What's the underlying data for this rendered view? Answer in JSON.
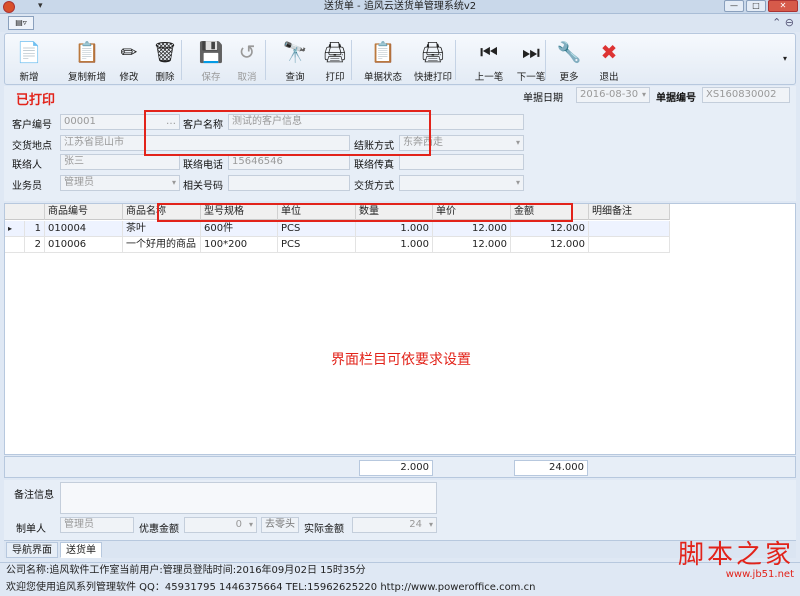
{
  "window": {
    "title": "送货单 - 追风云送货单管理系统v2",
    "qa": "▾",
    "min": "—",
    "max": "□",
    "close": "✕"
  },
  "ribbon": {
    "app_btn": "▤▿",
    "right": "⌃ ⊖"
  },
  "toolbar": [
    {
      "name": "new",
      "label": "新增",
      "icon": "📄",
      "disabled": false
    },
    {
      "name": "copy-new",
      "label": "复制新增",
      "icon": "📋",
      "disabled": false
    },
    {
      "name": "edit",
      "label": "修改",
      "icon": "✏",
      "disabled": false
    },
    {
      "name": "delete",
      "label": "删除",
      "icon": "🗑",
      "disabled": false
    },
    {
      "name": "save",
      "label": "保存",
      "icon": "💾",
      "disabled": true
    },
    {
      "name": "cancel",
      "label": "取消",
      "icon": "↺",
      "disabled": true
    },
    {
      "name": "query",
      "label": "查询",
      "icon": "🔭",
      "disabled": false
    },
    {
      "name": "print",
      "label": "打印",
      "icon": "🖨",
      "disabled": false
    },
    {
      "name": "doc-status",
      "label": "单据状态",
      "icon": "📋",
      "disabled": false
    },
    {
      "name": "quick-print",
      "label": "快捷打印",
      "icon": "🖨",
      "disabled": false
    },
    {
      "name": "prev",
      "label": "上一笔",
      "icon": "⏮",
      "disabled": false
    },
    {
      "name": "next",
      "label": "下一笔",
      "icon": "⏭",
      "disabled": false
    },
    {
      "name": "more",
      "label": "更多",
      "icon": "🔧",
      "disabled": false
    },
    {
      "name": "exit",
      "label": "退出",
      "icon": "✖",
      "disabled": false
    }
  ],
  "form": {
    "status": "已打印",
    "doc_date_label": "单据日期",
    "doc_date": "2016-08-30",
    "doc_no_label": "单据编号",
    "doc_no": "XS160830002",
    "cust_no_label": "客户编号",
    "cust_no": "00001",
    "cust_name_label": "客户名称",
    "cust_name": "测试的客户信息",
    "deliver_label": "交货地点",
    "deliver": "江苏省昆山市",
    "settle_label": "结账方式",
    "settle": "东奔西走",
    "contact_label": "联络人",
    "contact": "张三",
    "phone_label": "联络电话",
    "phone": "15646546",
    "fax_label": "联络传真",
    "fax": "",
    "sales_label": "业务员",
    "sales": "管理员",
    "ref_label": "相关号码",
    "ref": "",
    "deliv_method_label": "交货方式",
    "deliv_method": ""
  },
  "grid": {
    "headers": [
      "商品编号",
      "商品名称",
      "型号规格",
      "单位",
      "数量",
      "单价",
      "金额",
      "明细备注"
    ],
    "rows": [
      {
        "marker": "▸",
        "idx": "1",
        "code": "010004",
        "name": "茶叶",
        "spec": "600件",
        "unit": "PCS",
        "qty": "1.000",
        "price": "12.000",
        "amount": "12.000",
        "note": ""
      },
      {
        "marker": "",
        "idx": "2",
        "code": "010006",
        "name": "一个好用的商品",
        "spec": "100*200",
        "unit": "PCS",
        "qty": "1.000",
        "price": "12.000",
        "amount": "12.000",
        "note": ""
      }
    ],
    "note": "界面栏目可依要求设置",
    "sum_qty": "2.000",
    "sum_amount": "24.000"
  },
  "bottom": {
    "remark_label": "备注信息",
    "remark": "",
    "maker_label": "制单人",
    "maker": "管理员",
    "discount_label": "优惠金额",
    "discount": "0",
    "round_btn": "去零头",
    "actual_label": "实际金额",
    "actual": "24"
  },
  "tabs": [
    "导航界面",
    "送货单"
  ],
  "status": {
    "line1": "公司名称:追风软件工作室当前用户:管理员登陆时间:2016年09月02日 15时35分",
    "line2": "欢迎您使用追风系列管理软件 QQ：45931795 1446375664 TEL:15962625220 http://www.poweroffice.com.cn"
  },
  "watermark": {
    "big": "脚本之家",
    "small": "www.jb51.net"
  }
}
